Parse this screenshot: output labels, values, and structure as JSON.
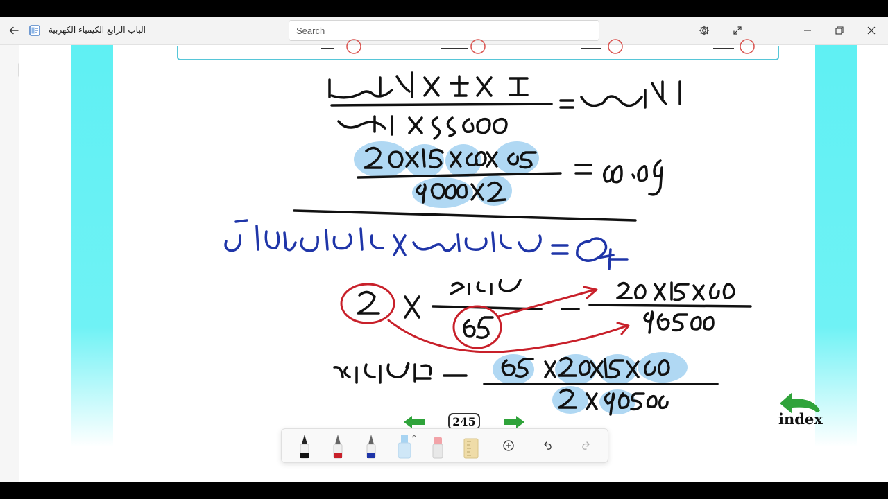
{
  "window": {
    "title": "الباب الرابع الكيمياء الكهربية",
    "back_icon": "back-arrow-icon",
    "app_icon": "book-app-icon"
  },
  "search": {
    "placeholder": "Search"
  },
  "titlebar_controls": {
    "settings_icon": "gear-icon",
    "fullscreen_icon": "expand-icon",
    "minimize_icon": "minimize-icon",
    "restore_icon": "restore-icon",
    "close_icon": "close-icon"
  },
  "page": {
    "number": "245",
    "index_label": "index",
    "colors": {
      "page_border": "#5ff0f3",
      "ink_black": "#111111",
      "ink_blue": "#1f35a8",
      "ink_red": "#c8202a",
      "highlight": "#a8d4f2",
      "nav_green": "#2fa33a"
    }
  },
  "ink_toolbar": {
    "tools": [
      "black-pen",
      "red-pen",
      "blue-pen",
      "highlighter",
      "eraser",
      "ruler",
      "lasso-select",
      "undo",
      "redo"
    ]
  }
}
